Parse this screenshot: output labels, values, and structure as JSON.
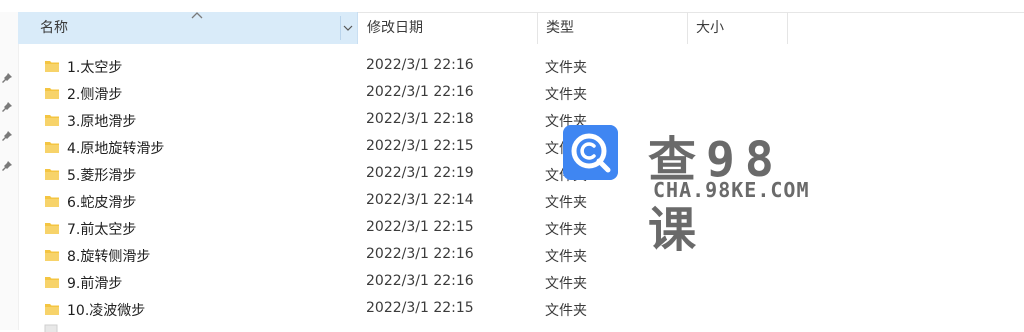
{
  "columns": {
    "name": "名称",
    "date": "修改日期",
    "type": "类型",
    "size": "大小"
  },
  "files": [
    {
      "name": "1.太空步",
      "date": "2022/3/1 22:16",
      "type": "文件夹"
    },
    {
      "name": "2.侧滑步",
      "date": "2022/3/1 22:16",
      "type": "文件夹"
    },
    {
      "name": "3.原地滑步",
      "date": "2022/3/1 22:18",
      "type": "文件夹"
    },
    {
      "name": "4.原地旋转滑步",
      "date": "2022/3/1 22:15",
      "type": "文件夹"
    },
    {
      "name": "5.菱形滑步",
      "date": "2022/3/1 22:19",
      "type": "文件夹"
    },
    {
      "name": "6.蛇皮滑步",
      "date": "2022/3/1 22:14",
      "type": "文件夹"
    },
    {
      "name": "7.前太空步",
      "date": "2022/3/1 22:15",
      "type": "文件夹"
    },
    {
      "name": "8.旋转侧滑步",
      "date": "2022/3/1 22:16",
      "type": "文件夹"
    },
    {
      "name": "9.前滑步",
      "date": "2022/3/1 22:16",
      "type": "文件夹"
    },
    {
      "name": "10.凌波微步",
      "date": "2022/3/1 22:15",
      "type": "文件夹"
    }
  ],
  "watermark": {
    "title": "查98课",
    "url": "CHA.98KE.COM",
    "icon": "search-c-logo-icon"
  },
  "colors": {
    "header_selected": "#d9ebf9",
    "folder": "#f4c542",
    "watermark_icon": "#3f86f2",
    "watermark_text": "#6a6a6a"
  }
}
